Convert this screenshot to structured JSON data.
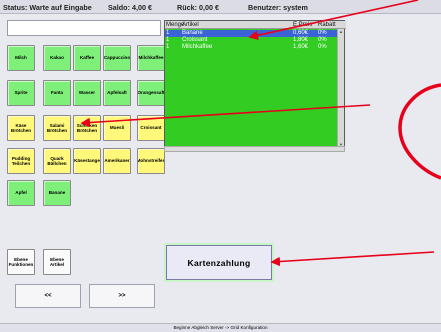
{
  "status": {
    "status_text": "Status: Warte auf Eingabe",
    "saldo_text": "Saldo: 4,00 €",
    "rueck_text": "Rück: 0,00 €",
    "benutzer_text": "Benutzer: system"
  },
  "products": [
    {
      "label": "Milch",
      "color": "green"
    },
    {
      "label": "Kakao",
      "color": "green"
    },
    {
      "label": "Kaffee",
      "color": "green"
    },
    {
      "label": "Cappuccino",
      "color": "green"
    },
    {
      "label": "Milchkaffee",
      "color": "green"
    },
    {
      "label": "Sprite",
      "color": "green"
    },
    {
      "label": "Fanta",
      "color": "green"
    },
    {
      "label": "Wasser",
      "color": "green"
    },
    {
      "label": "Apfelsaft",
      "color": "green"
    },
    {
      "label": "Orangensaft",
      "color": "green"
    },
    {
      "label": "Käse Brötchen",
      "color": "yellow"
    },
    {
      "label": "Salami Brötchen",
      "color": "yellow"
    },
    {
      "label": "Schinken Brötchen",
      "color": "yellow"
    },
    {
      "label": "Muesli",
      "color": "yellow"
    },
    {
      "label": "Croissant",
      "color": "yellow"
    },
    {
      "label": "Pudding Teilchen",
      "color": "yellow"
    },
    {
      "label": "Quark Bällchen",
      "color": "yellow"
    },
    {
      "label": "Käsestange",
      "color": "yellow"
    },
    {
      "label": "Amerikaner",
      "color": "yellow"
    },
    {
      "label": "Mohnstreifen",
      "color": "yellow"
    },
    {
      "label": "Apfel",
      "color": "green"
    },
    {
      "label": "Banane",
      "color": "green"
    }
  ],
  "functions": [
    {
      "label": "Ebene Funktionen"
    },
    {
      "label": "Ebene Artikel"
    }
  ],
  "nav": {
    "prev_label": "<<",
    "next_label": ">>"
  },
  "order": {
    "headers": {
      "menge": "Menge",
      "artikel": "Artikel",
      "epreis": "E.Preis",
      "rabatt": "Rabatt"
    },
    "rows": [
      {
        "menge": "1",
        "artikel": "Banane",
        "epreis": "0,60€",
        "rabatt": "0%",
        "selected": true
      },
      {
        "menge": "1",
        "artikel": "Croissant",
        "epreis": "1,80€",
        "rabatt": "0%",
        "selected": false
      },
      {
        "menge": "1",
        "artikel": "Milchkaffee",
        "epreis": "1,60€",
        "rabatt": "0%",
        "selected": false
      }
    ]
  },
  "pay_button_label": "Kartenzahlung",
  "footer_text": "Beginne Abgleich Server -> Grid Konfiguration",
  "colors": {
    "green": "#7ef07a",
    "yellow": "#fff87a",
    "order_bg": "#33cc22",
    "selected_row": "#3b63d6",
    "annotation": "#e8001a"
  }
}
